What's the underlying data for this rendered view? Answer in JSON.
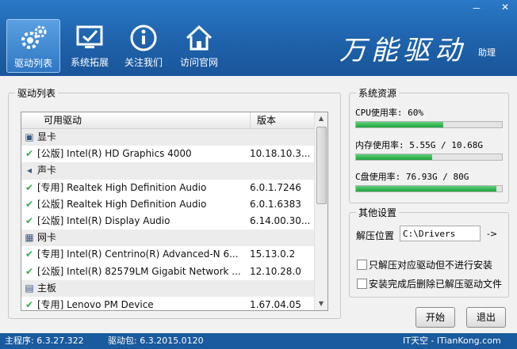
{
  "window": {
    "minimize": "－",
    "close": "✕"
  },
  "nav": {
    "items": [
      {
        "label": "驱动列表",
        "icon": "gear-icon"
      },
      {
        "label": "系统拓展",
        "icon": "monitor-icon"
      },
      {
        "label": "关注我们",
        "icon": "info-icon"
      },
      {
        "label": "访问官网",
        "icon": "home-icon"
      }
    ]
  },
  "brand": {
    "title": "万能驱动",
    "subtitle": "助理"
  },
  "driver_list": {
    "group_title": "驱动列表",
    "col_name": "可用驱动",
    "col_version": "版本",
    "rows": [
      {
        "type": "category",
        "name": "显卡",
        "icon": "display-icon",
        "version": ""
      },
      {
        "type": "driver",
        "name": "[公版] Intel(R) HD Graphics 4000",
        "version": "10.18.10.3..."
      },
      {
        "type": "category",
        "name": "声卡",
        "icon": "speaker-icon",
        "version": ""
      },
      {
        "type": "driver",
        "name": "[专用] Realtek High Definition Audio",
        "version": "6.0.1.7246"
      },
      {
        "type": "driver",
        "name": "[公版] Realtek High Definition Audio",
        "version": "6.0.1.6383"
      },
      {
        "type": "driver",
        "name": "[公版] Intel(R) Display Audio",
        "version": "6.14.00.30..."
      },
      {
        "type": "category",
        "name": "网卡",
        "icon": "network-icon",
        "version": ""
      },
      {
        "type": "driver",
        "name": "[专用] Intel(R) Centrino(R) Advanced-N 6...",
        "version": "15.13.0.2"
      },
      {
        "type": "driver",
        "name": "[公版] Intel(R) 82579LM Gigabit Network ...",
        "version": "12.10.28.0"
      },
      {
        "type": "category",
        "name": "主板",
        "icon": "board-icon",
        "version": ""
      },
      {
        "type": "driver",
        "name": "[专用] Lenovo PM Device",
        "version": "1.67.04.05"
      }
    ]
  },
  "resources": {
    "group_title": "系统资源",
    "cpu": {
      "label": "CPU使用率:  60%",
      "percent": 60
    },
    "mem": {
      "label": "内存使用率:  5.55G / 10.68G",
      "percent": 52
    },
    "disk": {
      "label": "C盘使用率:  76.93G / 80G",
      "percent": 96
    }
  },
  "settings": {
    "group_title": "其他设置",
    "extract_label": "解压位置",
    "extract_path": "C:\\Drivers",
    "browse": "->",
    "opt1": "只解压对应驱动但不进行安装",
    "opt2": "安装完成后删除已解压驱动文件"
  },
  "buttons": {
    "start": "开始",
    "exit": "退出"
  },
  "status": {
    "main_version": "主程序:  6.3.27.322",
    "driver_pack": "驱动包:  6.3.2015.0120",
    "site": "IT天空 - ITianKong.com"
  },
  "colors": {
    "accent": "#1f64ad",
    "progress": "#2bb34a"
  }
}
